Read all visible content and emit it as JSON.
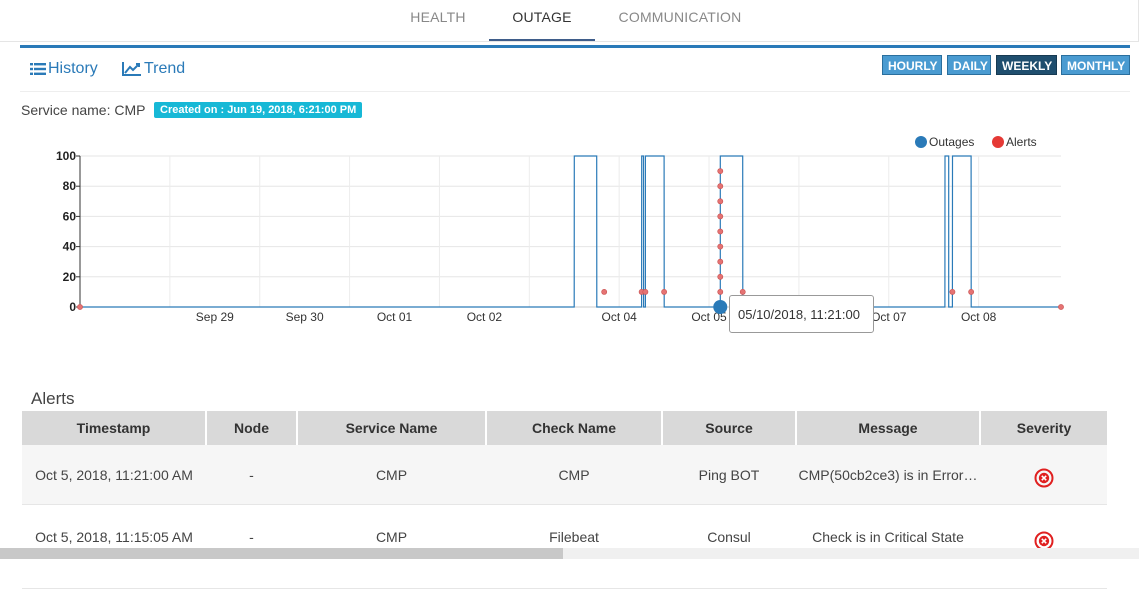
{
  "tabs": [
    {
      "label": "HEALTH"
    },
    {
      "label": "OUTAGE"
    },
    {
      "label": "COMMUNICATION"
    }
  ],
  "view_toggle": {
    "history": "History",
    "trend": "Trend"
  },
  "periods": [
    "HOURLY",
    "DAILY",
    "WEEKLY",
    "MONTHLY"
  ],
  "active_period": "WEEKLY",
  "service": {
    "label": "Service name: CMP",
    "created": "Created on : Jun 19, 2018, 6:21:00 PM"
  },
  "chart_data": {
    "type": "line",
    "series": [
      {
        "name": "Outages",
        "color": "#2a7ab8"
      },
      {
        "name": "Alerts",
        "color": "#e53935"
      }
    ],
    "y_ticks": [
      0,
      20,
      40,
      60,
      80,
      100
    ],
    "ylim": [
      0,
      100
    ],
    "x_tick_labels": [
      "Sep 29",
      "Sep 30",
      "Oct 01",
      "Oct 02",
      "Oct 04",
      "Oct 05",
      "Oct 07",
      "Oct 08"
    ],
    "legend_position": "top-right",
    "grid": true,
    "outage_points": [
      [
        "2018-09-28 00:00",
        0
      ],
      [
        "2018-10-03 12:00",
        0
      ],
      [
        "2018-10-03 12:01",
        100
      ],
      [
        "2018-10-03 18:00",
        100
      ],
      [
        "2018-10-03 18:01",
        0
      ],
      [
        "2018-10-04 06:00",
        0
      ],
      [
        "2018-10-04 06:01",
        100
      ],
      [
        "2018-10-04 06:30",
        100
      ],
      [
        "2018-10-04 06:31",
        0
      ],
      [
        "2018-10-04 07:00",
        0
      ],
      [
        "2018-10-04 07:01",
        100
      ],
      [
        "2018-10-04 12:00",
        100
      ],
      [
        "2018-10-04 12:01",
        0
      ],
      [
        "2018-10-05 03:00",
        0
      ],
      [
        "2018-10-05 03:01",
        100
      ],
      [
        "2018-10-05 09:00",
        100
      ],
      [
        "2018-10-05 09:01",
        0
      ],
      [
        "2018-10-07 15:00",
        0
      ],
      [
        "2018-10-07 15:01",
        100
      ],
      [
        "2018-10-07 16:00",
        100
      ],
      [
        "2018-10-07 16:01",
        0
      ],
      [
        "2018-10-07 17:00",
        0
      ],
      [
        "2018-10-07 17:01",
        100
      ],
      [
        "2018-10-07 22:00",
        100
      ],
      [
        "2018-10-07 22:01",
        0
      ],
      [
        "2018-10-08 22:00",
        0
      ]
    ],
    "alert_points": [
      [
        "2018-09-28 00:00",
        0
      ],
      [
        "2018-10-03 20:00",
        10
      ],
      [
        "2018-10-04 06:00",
        10
      ],
      [
        "2018-10-04 07:00",
        10
      ],
      [
        "2018-10-04 12:00",
        10
      ],
      [
        "2018-10-05 03:00",
        10
      ],
      [
        "2018-10-05 03:00",
        20
      ],
      [
        "2018-10-05 03:00",
        30
      ],
      [
        "2018-10-05 03:00",
        40
      ],
      [
        "2018-10-05 03:00",
        50
      ],
      [
        "2018-10-05 03:00",
        60
      ],
      [
        "2018-10-05 03:00",
        70
      ],
      [
        "2018-10-05 03:00",
        80
      ],
      [
        "2018-10-05 03:00",
        90
      ],
      [
        "2018-10-05 09:00",
        10
      ],
      [
        "2018-10-07 17:00",
        10
      ],
      [
        "2018-10-07 22:00",
        10
      ],
      [
        "2018-10-08 22:00",
        0
      ]
    ],
    "highlight_point": [
      "2018-10-05 03:00",
      0
    ],
    "tooltip": "05/10/2018, 11:21:00",
    "x_domain": [
      "2018-09-28 00:00",
      "2018-10-08 22:00"
    ]
  },
  "alerts": {
    "title": "Alerts",
    "columns": [
      "Timestamp",
      "Node",
      "Service Name",
      "Check Name",
      "Source",
      "Message",
      "Severity"
    ],
    "rows": [
      {
        "timestamp": "Oct 5, 2018, 11:21:00 AM",
        "node": "-",
        "service": "CMP",
        "check": "CMP",
        "source": "Ping BOT",
        "message": "CMP(50cb2ce3) is in Error…",
        "severity": "error-icon"
      },
      {
        "timestamp": "Oct 5, 2018, 11:15:05 AM",
        "node": "-",
        "service": "CMP",
        "check": "Filebeat",
        "source": "Consul",
        "message": "Check is in Critical State",
        "severity": "error-icon"
      }
    ]
  }
}
